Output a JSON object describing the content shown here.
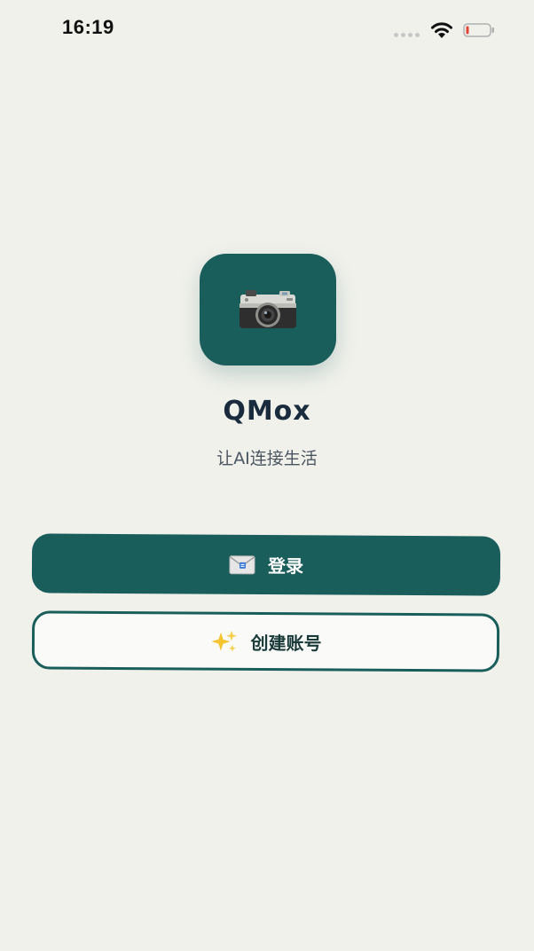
{
  "status_bar": {
    "time": "16:19",
    "icons": [
      "signal-dots-icon",
      "wifi-icon",
      "battery-low-icon"
    ],
    "battery_color": "#e0453a"
  },
  "app": {
    "icon": "camera-icon",
    "name": "QMox",
    "tagline": "让AI连接生活"
  },
  "buttons": {
    "login": {
      "icon": "envelope-icon",
      "label": "登录"
    },
    "create": {
      "icon": "sparkles-icon",
      "label": "创建账号"
    }
  },
  "colors": {
    "background": "#f1f1ec",
    "primary": "#1a5e5b",
    "title": "#1a2b3d",
    "subtitle": "#4b5560",
    "sparkle": "#f4c430"
  }
}
